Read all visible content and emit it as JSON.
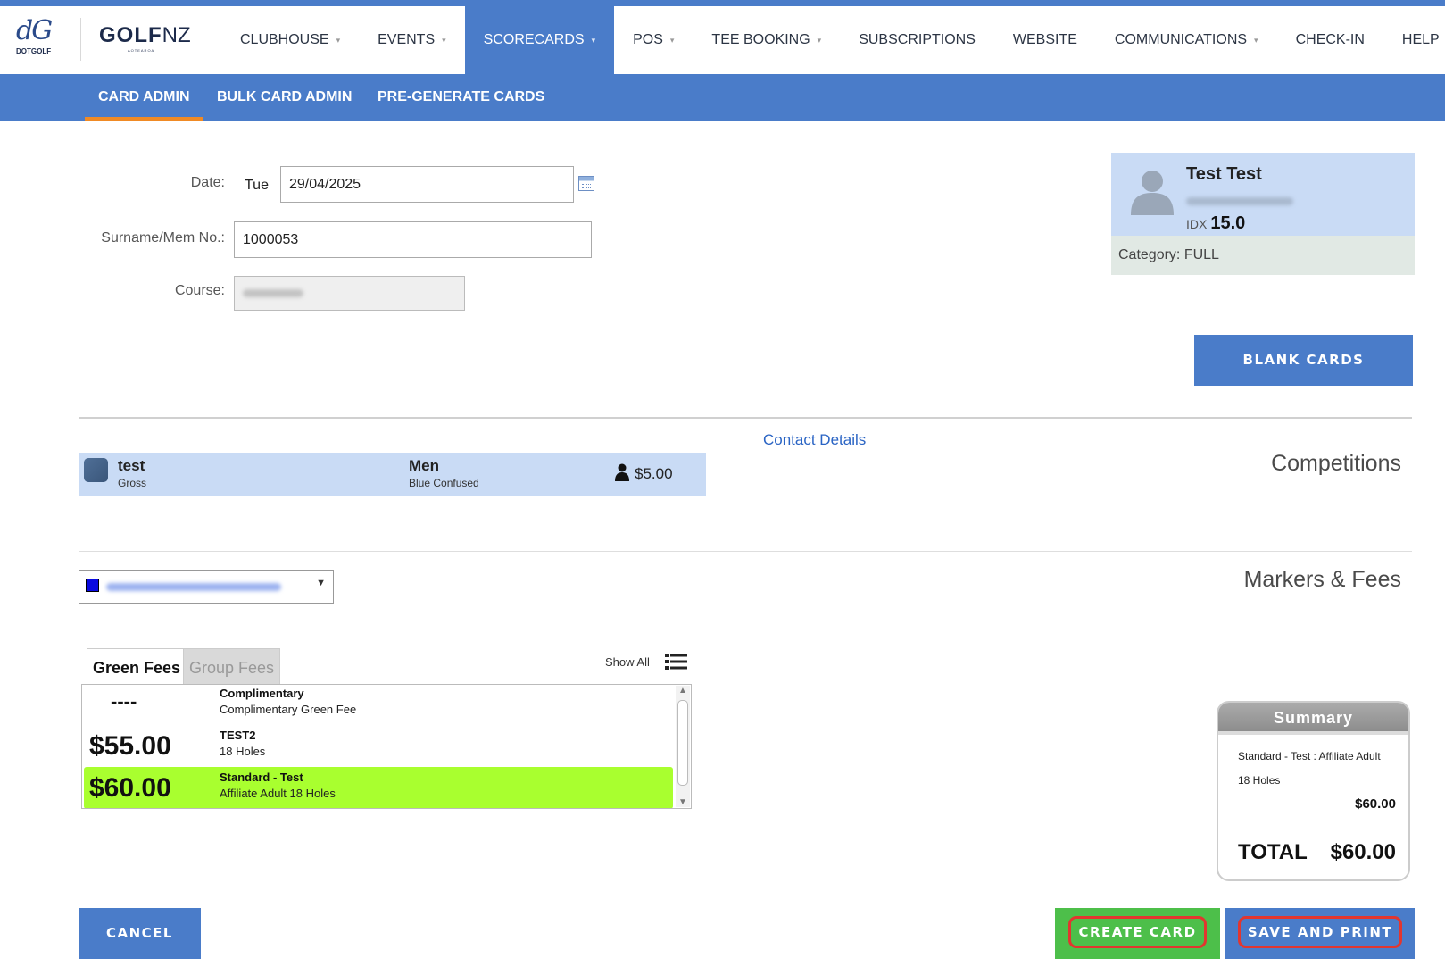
{
  "brand": {
    "dotgolf_text": "DOTGOLF",
    "golf_bold": "GOLF",
    "golf_nz": "NZ",
    "golf_tagline": "AOTEAROA"
  },
  "nav": {
    "items": [
      {
        "label": "CLUBHOUSE",
        "caret": true
      },
      {
        "label": "EVENTS",
        "caret": true
      },
      {
        "label": "SCORECARDS",
        "caret": true,
        "active": true
      },
      {
        "label": "POS",
        "caret": true
      },
      {
        "label": "TEE BOOKING",
        "caret": true
      },
      {
        "label": "SUBSCRIPTIONS",
        "caret": false
      },
      {
        "label": "WEBSITE",
        "caret": false
      },
      {
        "label": "COMMUNICATIONS",
        "caret": true
      },
      {
        "label": "CHECK-IN",
        "caret": false
      },
      {
        "label": "HELP",
        "caret": false
      }
    ],
    "caret_glyph": "▾"
  },
  "subnav": {
    "card_admin": "CARD ADMIN",
    "bulk_card_admin": "BULK CARD ADMIN",
    "pre_generate": "PRE-GENERATE CARDS"
  },
  "form": {
    "date_label": "Date:",
    "day": "Tue",
    "date_value": "29/04/2025",
    "surname_label": "Surname/Mem No.:",
    "surname_value": "1000053",
    "course_label": "Course:"
  },
  "member": {
    "name": "Test Test",
    "idx_label": "IDX",
    "idx_value": "15.0",
    "category": "Category: FULL"
  },
  "buttons": {
    "blank_cards": "BLANK CARDS",
    "cancel": "CANCEL",
    "create_card": "CREATE CARD",
    "save_and_print": "SAVE AND PRINT"
  },
  "competitions": {
    "contact_details": "Contact Details",
    "title": "Competitions",
    "row": {
      "name": "test",
      "format": "Gross",
      "division": "Men",
      "tee": "Blue Confused",
      "price": "$5.00"
    }
  },
  "markers": {
    "title": "Markers & Fees"
  },
  "fees": {
    "tab_green": "Green Fees",
    "tab_group": "Group Fees",
    "show_all": "Show All",
    "items": [
      {
        "amount": "----",
        "name": "Complimentary",
        "desc": "Complimentary Green Fee"
      },
      {
        "amount": "$55.00",
        "name": "TEST2",
        "desc": "18 Holes"
      },
      {
        "amount": "$60.00",
        "name": "Standard - Test",
        "desc": "Affiliate Adult 18 Holes",
        "selected": true
      }
    ]
  },
  "summary": {
    "title": "Summary",
    "line1": "Standard - Test : Affiliate Adult",
    "line2": "18 Holes",
    "line_amount": "$60.00",
    "total_label": "TOTAL",
    "total_value": "$60.00"
  },
  "colors": {
    "nav_blue": "#4a7cc9",
    "accent_orange": "#f08a24",
    "selected_fee": "#a9ff2f",
    "create_green": "#4dbf4a",
    "highlight_red": "#e2362f"
  }
}
